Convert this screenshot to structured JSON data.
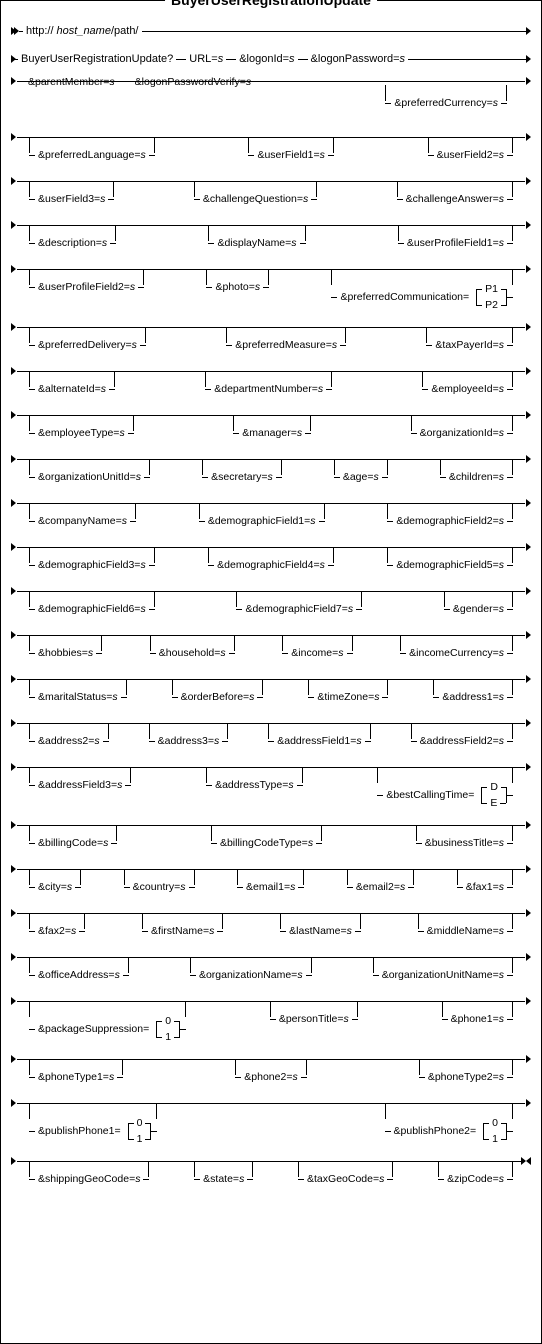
{
  "title": "BuyerUserRegistrationUpdate",
  "url_prefix": "http://",
  "url_host": "host_name",
  "url_path": "/path/",
  "cmd": "BuyerUserRegistrationUpdate?",
  "url_lbl": "URL=",
  "s": "s",
  "row2": {
    "logonId": "&logonId=",
    "logonPassword": "&logonPassword="
  },
  "row3": {
    "parentMember": "&parentMember=",
    "logonPasswordVerify": "&logonPasswordVerify=",
    "preferredCurrency": "&preferredCurrency="
  },
  "row4": {
    "preferredLanguage": "&preferredLanguage=",
    "userField1": "&userField1=",
    "userField2": "&userField2="
  },
  "row5": {
    "userField3": "&userField3=",
    "challengeQuestion": "&challengeQuestion=",
    "challengeAnswer": "&challengeAnswer="
  },
  "row6": {
    "description": "&description=",
    "displayName": "&displayName=",
    "userProfileField1": "&userProfileField1="
  },
  "row7": {
    "userProfileField2": "&userProfileField2=",
    "photo": "&photo=",
    "preferredCommunication": "&preferredCommunication=",
    "p1": "P1",
    "p2": "P2"
  },
  "row8": {
    "preferredDelivery": "&preferredDelivery=",
    "preferredMeasure": "&preferredMeasure=",
    "taxPayerId": "&taxPayerId="
  },
  "row9": {
    "alternateId": "&alternateId=",
    "departmentNumber": "&departmentNumber=",
    "employeeId": "&employeeId="
  },
  "row10": {
    "employeeType": "&employeeType=",
    "manager": "&manager=",
    "organizationId": "&organizationId="
  },
  "row11": {
    "organizationUnitId": "&organizationUnitId=",
    "secretary": "&secretary=",
    "age": "&age=",
    "children": "&children="
  },
  "row12": {
    "companyName": "&companyName=",
    "demographicField1": "&demographicField1=",
    "demographicField2": "&demographicField2="
  },
  "row13": {
    "demographicField3": "&demographicField3=",
    "demographicField4": "&demographicField4=",
    "demographicField5": "&demographicField5="
  },
  "row14": {
    "demographicField6": "&demographicField6=",
    "demographicField7": "&demographicField7=",
    "gender": "&gender="
  },
  "row15": {
    "hobbies": "&hobbies=",
    "household": "&household=",
    "income": "&income=",
    "incomeCurrency": "&incomeCurrency="
  },
  "row16": {
    "maritalStatus": "&maritalStatus=",
    "orderBefore": "&orderBefore=",
    "timeZone": "&timeZone=",
    "address1": "&address1="
  },
  "row17": {
    "address2": "&address2=",
    "address3": "&address3=",
    "addressField1": "&addressField1=",
    "addressField2": "&addressField2="
  },
  "row18": {
    "addressField3": "&addressField3=",
    "addressType": "&addressType=",
    "bestCallingTime": "&bestCallingTime=",
    "d": "D",
    "e": "E"
  },
  "row19": {
    "billingCode": "&billingCode=",
    "billingCodeType": "&billingCodeType=",
    "businessTitle": "&businessTitle="
  },
  "row20": {
    "city": "&city=",
    "country": "&country=",
    "email1": "&email1=",
    "email2": "&email2=",
    "fax1": "&fax1="
  },
  "row21": {
    "fax2": "&fax2=",
    "firstName": "&firstName=",
    "lastName": "&lastName=",
    "middleName": "&middleName="
  },
  "row22": {
    "officeAddress": "&officeAddress=",
    "organizationName": "&organizationName=",
    "organizationUnitName": "&organizationUnitName="
  },
  "row23": {
    "packageSuppression": "&packageSuppression=",
    "v0": "0",
    "v1": "1",
    "personTitle": "&personTitle=",
    "phone1": "&phone1="
  },
  "row24": {
    "phoneType1": "&phoneType1=",
    "phone2": "&phone2=",
    "phoneType2": "&phoneType2="
  },
  "row25": {
    "publishPhone1": "&publishPhone1=",
    "publishPhone2": "&publishPhone2=",
    "v0": "0",
    "v1": "1"
  },
  "row26": {
    "shippingGeoCode": "&shippingGeoCode=",
    "state": "&state=",
    "taxGeoCode": "&taxGeoCode=",
    "zipCode": "&zipCode="
  }
}
